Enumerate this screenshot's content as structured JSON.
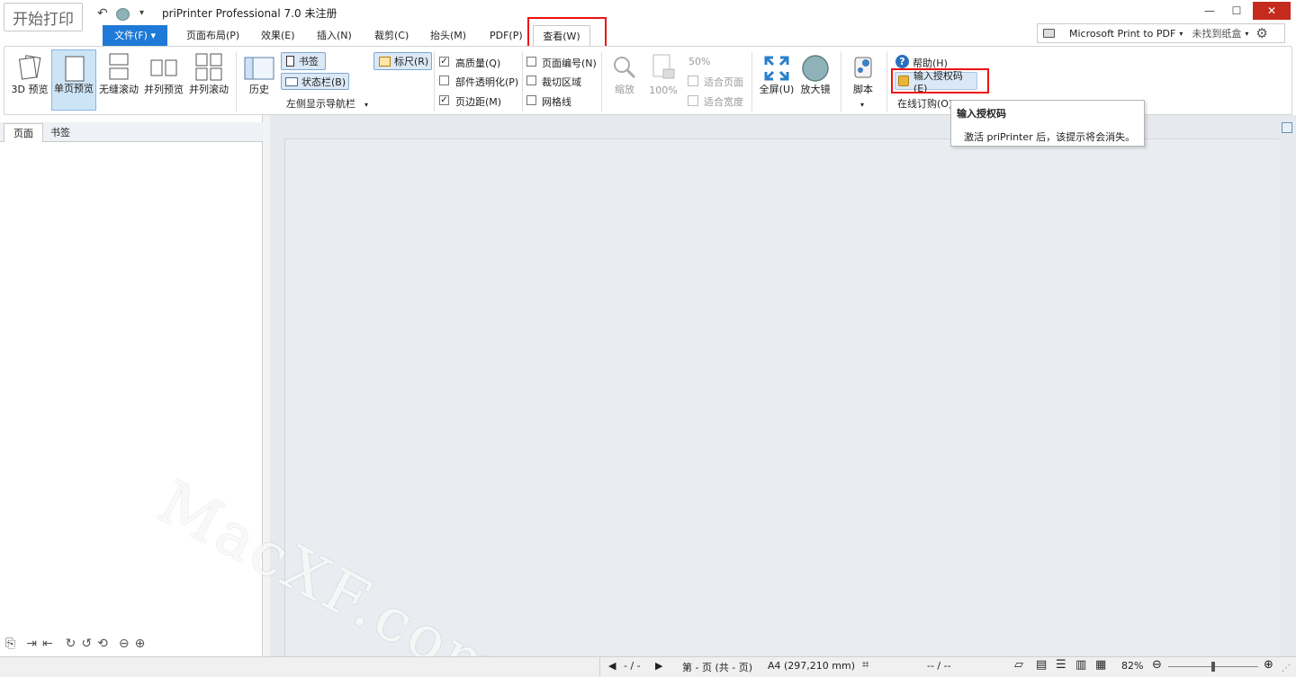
{
  "title_bar": {
    "start_button": "开始打印",
    "app_title": "priPrinter Professional 7.0 未注册",
    "minimize": "—",
    "maximize": "☐",
    "close": "✕"
  },
  "tabs": {
    "file": "文件(F) ▾",
    "items": [
      "页面布局(P)",
      "效果(E)",
      "插入(N)",
      "裁剪(C)",
      "抬头(M)",
      "PDF(P)"
    ],
    "view": "查看(W)"
  },
  "printer": {
    "name": "Microsoft Print to PDF",
    "paper": "未找到纸盒"
  },
  "ribbon": {
    "preview_3d": "3D 预览",
    "single_page": "单页预览",
    "seamless_scroll": "无缝滚动",
    "side_by_side": "并列预览",
    "side_scroll": "并列滚动",
    "history": "历史",
    "bookmarks": "书签",
    "statusbar": "状态栏(B)",
    "left_nav": "左侧显示导航栏",
    "ruler": "标尺(R)",
    "high_quality": "高质量(Q)",
    "part_transparency": "部件透明化(P)",
    "margins": "页边距(M)",
    "page_numbers": "页面编号(N)",
    "crop_area": "裁切区域",
    "grid": "网格线",
    "zoom": "缩放",
    "zoom_100": "100%",
    "zoom_50": "50%",
    "fit_page": "适合页面",
    "fit_width": "适合宽度",
    "fullscreen": "全屏(U)",
    "magnifier": "放大镜",
    "script": "脚本",
    "help": "帮助(H)",
    "enter_license": "输入授权码(E)",
    "online_order": "在线订购(O)"
  },
  "tooltip": {
    "title": "输入授权码",
    "body": "激活 priPrinter 后，该提示将会消失。"
  },
  "panel_tabs": [
    "页面",
    "书签"
  ],
  "status": {
    "nav": "- / -",
    "page_info": "第 - 页 (共 - 页)",
    "paper_size": "A4 (297,210 mm)",
    "coords": "-- / --",
    "zoom": "82%"
  },
  "watermark": "MacXF.com"
}
